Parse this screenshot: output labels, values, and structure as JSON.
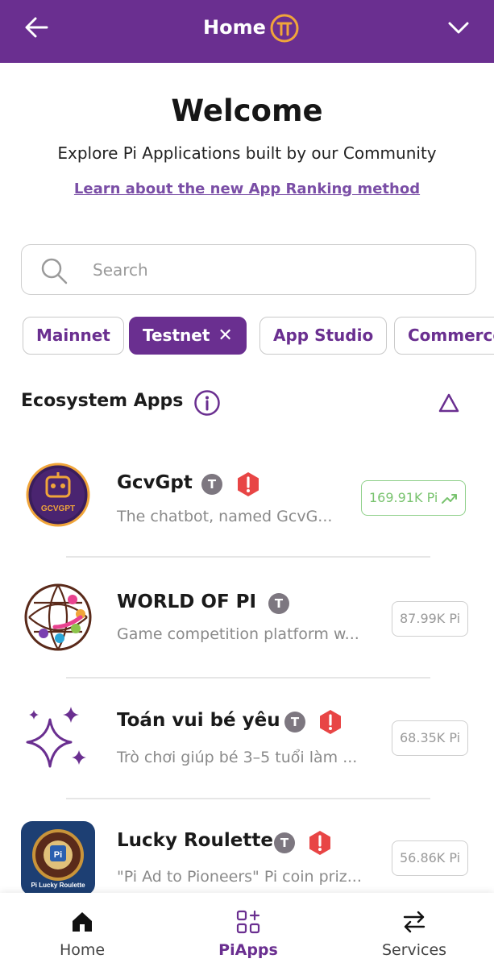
{
  "header": {
    "title": "Home",
    "logo": "pi-coin-icon",
    "accent": "#6a2f90",
    "logo_color": "#f0a53a"
  },
  "welcome": {
    "title": "Welcome",
    "subtitle": "Explore Pi Applications built by our Community",
    "link": "Learn about the new App Ranking method"
  },
  "search": {
    "placeholder": "Search",
    "value": ""
  },
  "filters": [
    {
      "label": "Mainnet",
      "active": false
    },
    {
      "label": "Testnet",
      "active": true,
      "close": "✕"
    },
    {
      "label": "App Studio",
      "active": false
    },
    {
      "label": "Commerce",
      "active": false
    }
  ],
  "section": {
    "title": "Ecosystem Apps"
  },
  "apps": [
    {
      "name": "GcvGpt",
      "badge": "T",
      "warning": true,
      "description": "The chatbot, named GcvG...",
      "stake": "169.91K Pi",
      "trending": true,
      "logo_text": "GCVGPT"
    },
    {
      "name": "WORLD OF PI",
      "badge": "T",
      "warning": false,
      "description": "Game competition platform w...",
      "stake": "87.99K Pi",
      "trending": false
    },
    {
      "name": "Toán vui bé yêu",
      "badge": "T",
      "warning": true,
      "description": "Trò chơi giúp bé 3–5 tuổi làm ...",
      "stake": "68.35K Pi",
      "trending": false
    },
    {
      "name": "Lucky Roulette",
      "badge": "T",
      "warning": true,
      "description": "\"Pi Ad to Pioneers\" Pi coin priz...",
      "stake": "56.86K Pi",
      "trending": false,
      "logo_text_1": "Pi",
      "logo_text_2": "Pi Lucky Roulette"
    }
  ],
  "bottom_nav": [
    {
      "label": "Home",
      "icon": "home-icon",
      "active": false
    },
    {
      "label": "PiApps",
      "icon": "apps-grid-icon",
      "active": true
    },
    {
      "label": "Services",
      "icon": "swap-arrows-icon",
      "active": false
    }
  ]
}
